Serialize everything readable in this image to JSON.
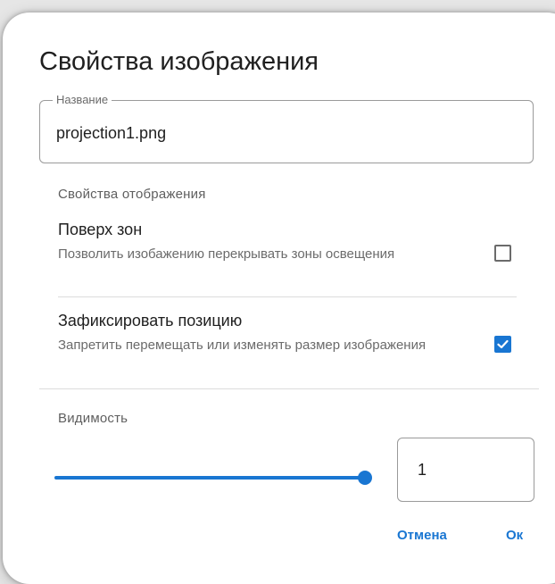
{
  "dialog": {
    "title": "Свойства изображения"
  },
  "name_field": {
    "label": "Название",
    "value": "projection1.png"
  },
  "display_section": {
    "heading": "Свойства отображения",
    "options": [
      {
        "title": "Поверх зон",
        "description": "Позволить изобажению перекрывать зоны освещения",
        "checked": false
      },
      {
        "title": "Зафиксировать позицию",
        "description": "Запретить перемещать или изменять размер изображения",
        "checked": true
      }
    ]
  },
  "visibility": {
    "heading": "Видимость",
    "value": "1",
    "fraction": 1.0
  },
  "actions": {
    "cancel_label": "Отмена",
    "ok_label": "Ок"
  },
  "colors": {
    "accent": "#1976d2",
    "text_primary": "#1f1f1f",
    "text_secondary": "#6b6b6b"
  }
}
